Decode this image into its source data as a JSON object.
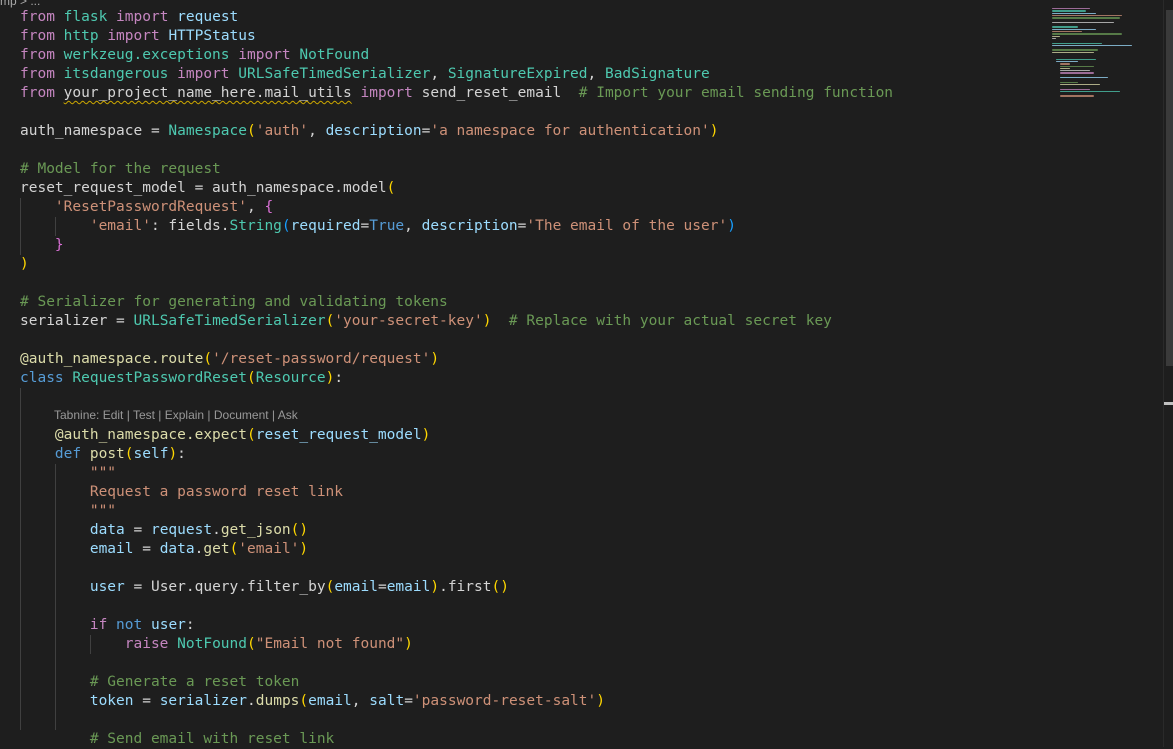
{
  "breadcrumb": "mp > ...",
  "editor": {
    "lines": [
      [
        [
          "kw",
          "from"
        ],
        [
          "pl",
          " "
        ],
        [
          "cls",
          "flask"
        ],
        [
          "pl",
          " "
        ],
        [
          "kw",
          "import"
        ],
        [
          "pl",
          " "
        ],
        [
          "var",
          "request"
        ]
      ],
      [
        [
          "kw",
          "from"
        ],
        [
          "pl",
          " "
        ],
        [
          "cls",
          "http"
        ],
        [
          "pl",
          " "
        ],
        [
          "kw",
          "import"
        ],
        [
          "pl",
          " "
        ],
        [
          "var",
          "HTTPStatus"
        ]
      ],
      [
        [
          "kw",
          "from"
        ],
        [
          "pl",
          " "
        ],
        [
          "cls",
          "werkzeug.exceptions"
        ],
        [
          "pl",
          " "
        ],
        [
          "kw",
          "import"
        ],
        [
          "pl",
          " "
        ],
        [
          "cls",
          "NotFound"
        ]
      ],
      [
        [
          "kw",
          "from"
        ],
        [
          "pl",
          " "
        ],
        [
          "cls",
          "itsdangerous"
        ],
        [
          "pl",
          " "
        ],
        [
          "kw",
          "import"
        ],
        [
          "pl",
          " "
        ],
        [
          "cls",
          "URLSafeTimedSerializer"
        ],
        [
          "pl",
          ", "
        ],
        [
          "cls",
          "SignatureExpired"
        ],
        [
          "pl",
          ", "
        ],
        [
          "cls",
          "BadSignature"
        ]
      ],
      [
        [
          "kw",
          "from"
        ],
        [
          "pl",
          " "
        ],
        [
          "pl squig",
          "your_project_name_here.mail_utils"
        ],
        [
          "pl",
          " "
        ],
        [
          "kw",
          "import"
        ],
        [
          "pl",
          " "
        ],
        [
          "pl",
          "send_reset_email"
        ],
        [
          "pl",
          "  "
        ],
        [
          "cmt",
          "# Import your email sending function"
        ]
      ],
      [],
      [
        [
          "pl",
          "auth_namespace = "
        ],
        [
          "cls",
          "Namespace"
        ],
        [
          "brk1",
          "("
        ],
        [
          "str",
          "'auth'"
        ],
        [
          "pl",
          ", "
        ],
        [
          "var",
          "description"
        ],
        [
          "pl",
          "="
        ],
        [
          "str",
          "'a namespace for authentication'"
        ],
        [
          "brk1",
          ")"
        ]
      ],
      [],
      [
        [
          "cmt",
          "# Model for the request"
        ]
      ],
      [
        [
          "pl",
          "reset_request_model = auth_namespace.model"
        ],
        [
          "brk1",
          "("
        ]
      ],
      [
        [
          "pl",
          "    "
        ],
        [
          "str",
          "'ResetPasswordRequest'"
        ],
        [
          "pl",
          ", "
        ],
        [
          "brk2",
          "{"
        ]
      ],
      [
        [
          "pl",
          "        "
        ],
        [
          "str",
          "'email'"
        ],
        [
          "pl",
          ": fields."
        ],
        [
          "cls",
          "String"
        ],
        [
          "brk3",
          "("
        ],
        [
          "var",
          "required"
        ],
        [
          "pl",
          "="
        ],
        [
          "kb",
          "True"
        ],
        [
          "pl",
          ", "
        ],
        [
          "var",
          "description"
        ],
        [
          "pl",
          "="
        ],
        [
          "str",
          "'The email of the user'"
        ],
        [
          "brk3",
          ")"
        ]
      ],
      [
        [
          "pl",
          "    "
        ],
        [
          "brk2",
          "}"
        ]
      ],
      [
        [
          "brk1",
          ")"
        ]
      ],
      [],
      [
        [
          "cmt",
          "# Serializer for generating and validating tokens"
        ]
      ],
      [
        [
          "pl",
          "serializer = "
        ],
        [
          "cls",
          "URLSafeTimedSerializer"
        ],
        [
          "brk1",
          "("
        ],
        [
          "str",
          "'your-secret-key'"
        ],
        [
          "brk1",
          ")"
        ],
        [
          "pl",
          "  "
        ],
        [
          "cmt",
          "# Replace with your actual secret key"
        ]
      ],
      [],
      [
        [
          "fn",
          "@auth_namespace.route"
        ],
        [
          "brk1",
          "("
        ],
        [
          "str",
          "'/reset-password/request'"
        ],
        [
          "brk1",
          ")"
        ]
      ],
      [
        [
          "kb",
          "class"
        ],
        [
          "pl",
          " "
        ],
        [
          "cls",
          "RequestPasswordReset"
        ],
        [
          "brk1",
          "("
        ],
        [
          "cls",
          "Resource"
        ],
        [
          "brk1",
          ")"
        ],
        [
          "pl",
          ":"
        ]
      ],
      [],
      [],
      [
        [
          "pl",
          "    "
        ],
        [
          "fn",
          "@auth_namespace.expect"
        ],
        [
          "brk1",
          "("
        ],
        [
          "var",
          "reset_request_model"
        ],
        [
          "brk1",
          ")"
        ]
      ],
      [
        [
          "pl",
          "    "
        ],
        [
          "kb",
          "def"
        ],
        [
          "pl",
          " "
        ],
        [
          "fn",
          "post"
        ],
        [
          "brk1",
          "("
        ],
        [
          "var",
          "self"
        ],
        [
          "brk1",
          ")"
        ],
        [
          "pl",
          ":"
        ]
      ],
      [
        [
          "pl",
          "        "
        ],
        [
          "str",
          "\"\"\""
        ]
      ],
      [
        [
          "pl",
          "        "
        ],
        [
          "str",
          "Request a password reset link"
        ]
      ],
      [
        [
          "pl",
          "        "
        ],
        [
          "str",
          "\"\"\""
        ]
      ],
      [
        [
          "pl",
          "        "
        ],
        [
          "var",
          "data"
        ],
        [
          "pl",
          " = "
        ],
        [
          "var",
          "request"
        ],
        [
          "pl",
          "."
        ],
        [
          "fn",
          "get_json"
        ],
        [
          "brk1",
          "()"
        ]
      ],
      [
        [
          "pl",
          "        "
        ],
        [
          "var",
          "email"
        ],
        [
          "pl",
          " = "
        ],
        [
          "var",
          "data"
        ],
        [
          "pl",
          "."
        ],
        [
          "fn",
          "get"
        ],
        [
          "brk1",
          "("
        ],
        [
          "str",
          "'email'"
        ],
        [
          "brk1",
          ")"
        ]
      ],
      [],
      [
        [
          "pl",
          "        "
        ],
        [
          "var",
          "user"
        ],
        [
          "pl",
          " = "
        ],
        [
          "pl",
          "User.query.filter_by"
        ],
        [
          "brk1",
          "("
        ],
        [
          "var",
          "email"
        ],
        [
          "pl",
          "="
        ],
        [
          "var",
          "email"
        ],
        [
          "brk1",
          ")"
        ],
        [
          "pl",
          ".first"
        ],
        [
          "brk1",
          "()"
        ]
      ],
      [],
      [
        [
          "pl",
          "        "
        ],
        [
          "kw",
          "if"
        ],
        [
          "pl",
          " "
        ],
        [
          "kb",
          "not"
        ],
        [
          "pl",
          " "
        ],
        [
          "var",
          "user"
        ],
        [
          "pl",
          ":"
        ]
      ],
      [
        [
          "pl",
          "            "
        ],
        [
          "kw",
          "raise"
        ],
        [
          "pl",
          " "
        ],
        [
          "cls",
          "NotFound"
        ],
        [
          "brk1",
          "("
        ],
        [
          "str",
          "\"Email not found\""
        ],
        [
          "brk1",
          ")"
        ]
      ],
      [],
      [
        [
          "pl",
          "        "
        ],
        [
          "cmt",
          "# Generate a reset token"
        ]
      ],
      [
        [
          "pl",
          "        "
        ],
        [
          "var",
          "token"
        ],
        [
          "pl",
          " = "
        ],
        [
          "var",
          "serializer"
        ],
        [
          "pl",
          "."
        ],
        [
          "fn",
          "dumps"
        ],
        [
          "brk1",
          "("
        ],
        [
          "var",
          "email"
        ],
        [
          "pl",
          ", "
        ],
        [
          "var",
          "salt"
        ],
        [
          "pl",
          "="
        ],
        [
          "str",
          "'password-reset-salt'"
        ],
        [
          "brk1",
          ")"
        ]
      ],
      [],
      [
        [
          "pl",
          "        "
        ],
        [
          "cmt",
          "# Send email with reset link"
        ]
      ]
    ],
    "codelens": "Tabnine: Edit | Test | Explain | Document | Ask"
  },
  "colors": {
    "background": "#1e1e1e",
    "keyword": "#c586c0",
    "builtin_keyword": "#569cd6",
    "class": "#4ec9b0",
    "function": "#dcdcaa",
    "string": "#ce9178",
    "comment": "#6a9955",
    "variable": "#9cdcfe"
  }
}
